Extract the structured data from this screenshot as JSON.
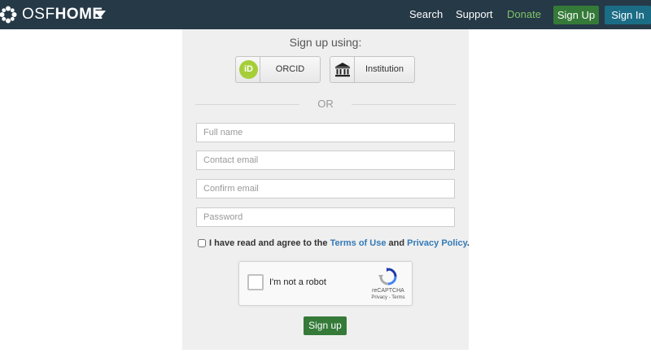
{
  "navbar": {
    "brand_prefix": "OSF",
    "brand_suffix": "HOME",
    "links": {
      "search": "Search",
      "support": "Support",
      "donate": "Donate"
    },
    "sign_up": "Sign Up",
    "sign_in": "Sign In"
  },
  "form": {
    "sign_up_using": "Sign up using:",
    "orcid_label": "ORCID",
    "orcid_icon_text": "iD",
    "institution_label": "Institution",
    "or_text": "OR",
    "full_name_placeholder": "Full name",
    "contact_email_placeholder": "Contact email",
    "confirm_email_placeholder": "Confirm email",
    "password_placeholder": "Password",
    "agree_prefix": "I have read and agree to the",
    "terms_link": "Terms of Use",
    "agree_and": "and",
    "privacy_link": "Privacy Policy",
    "agree_suffix": ".",
    "captcha_label": "I'm not a robot",
    "captcha_brand": "reCAPTCHA",
    "captcha_links": "Privacy - Terms",
    "submit": "Sign up"
  },
  "colors": {
    "navbar_bg": "#263947",
    "signup_green": "#357a38",
    "signin_blue": "#1b6d85",
    "donate_green": "#7ec468",
    "link_blue": "#337ab7",
    "orcid_green": "#a6ce39"
  },
  "icons": [
    "osf-logo-icon",
    "chevron-down-icon",
    "orcid-icon",
    "institution-icon",
    "recaptcha-icon"
  ]
}
